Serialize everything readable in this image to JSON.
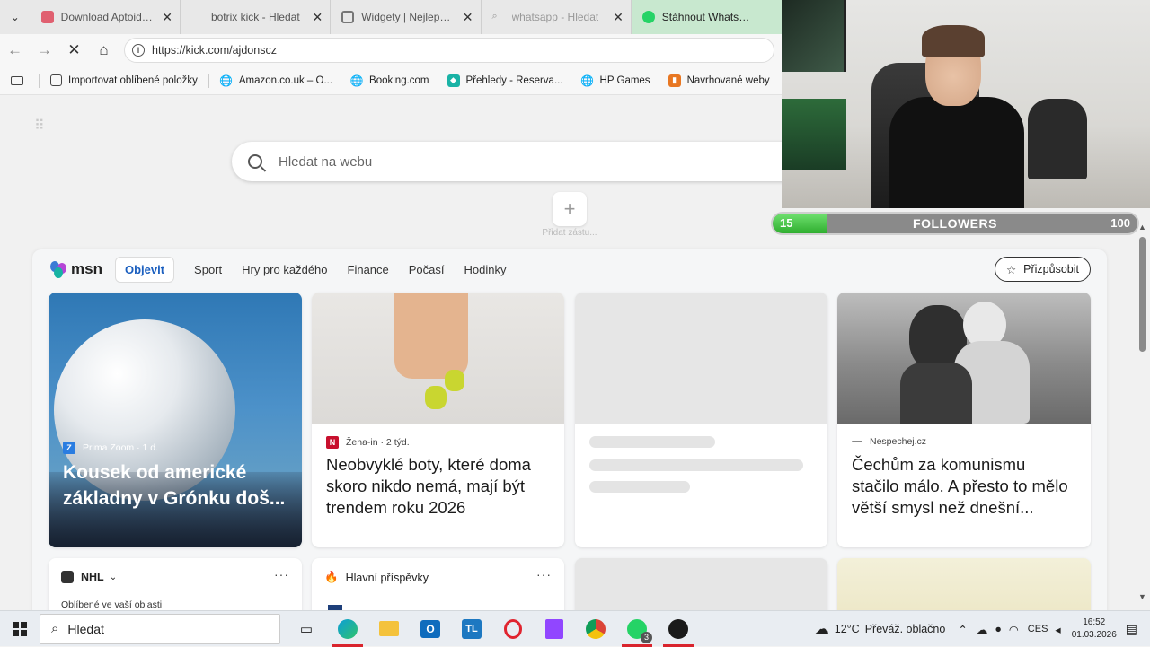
{
  "browser": {
    "tabs": [
      {
        "label": "Download Aptoide | Ap",
        "color": "#e06070"
      },
      {
        "label": "botrix kick - Hledat",
        "color": ""
      },
      {
        "label": "Widgety | Nejlepší softw",
        "color": "#777777"
      },
      {
        "label": "whatsapp - Hledat",
        "color": "#999999"
      },
      {
        "label": "Stáhnout WhatsApp",
        "color": "#25d366"
      }
    ],
    "url": "https://kick.com/ajdonscz",
    "favorites": [
      {
        "label": "Importovat oblíbené položky",
        "icon": "import-icon"
      },
      {
        "label": "Amazon.co.uk – O...",
        "icon": "globe-icon"
      },
      {
        "label": "Booking.com",
        "icon": "globe-icon"
      },
      {
        "label": "Přehledy - Reserva...",
        "icon": "reservation-icon"
      },
      {
        "label": "HP Games",
        "icon": "globe-icon"
      },
      {
        "label": "Navrhované weby",
        "icon": "suggested-icon"
      }
    ]
  },
  "newtab": {
    "search_placeholder": "Hledat na webu",
    "add_shortcut_label": "Přidat zástu..."
  },
  "msn": {
    "logo": "msn",
    "nav": [
      "Objevit",
      "Sport",
      "Hry pro každého",
      "Finance",
      "Počasí",
      "Hodinky"
    ],
    "personalize": "Přizpůsobit",
    "cards": [
      {
        "source": "Prima Zoom · 1 d.",
        "title": "Kousek od americké základny v Grónku doš..."
      },
      {
        "source": "Žena-in · 2 týd.",
        "title": "Neobvyklé boty, které doma skoro nikdo nemá, mají být trendem roku 2026"
      },
      {
        "source": "Nespechej.cz",
        "title": "Čechům za komunismu stačilo málo. A přesto to mělo větší smysl než dnešní..."
      }
    ],
    "nhl_label": "NHL",
    "nhl_sub": "Oblíbené ve vaší oblasti",
    "hlavni_label": "Hlavní příspěvky"
  },
  "overlay": {
    "followers_label": "FOLLOWERS",
    "followers_current": "15",
    "followers_goal": "100",
    "followers_progress": 0.15
  },
  "taskbar": {
    "search": "Hledat",
    "weather_temp": "12°C",
    "weather_desc": "Převáž. oblačno",
    "lang": "CES",
    "time": "16:52",
    "date": "01.03.2026",
    "whatsapp_badge": "3"
  }
}
